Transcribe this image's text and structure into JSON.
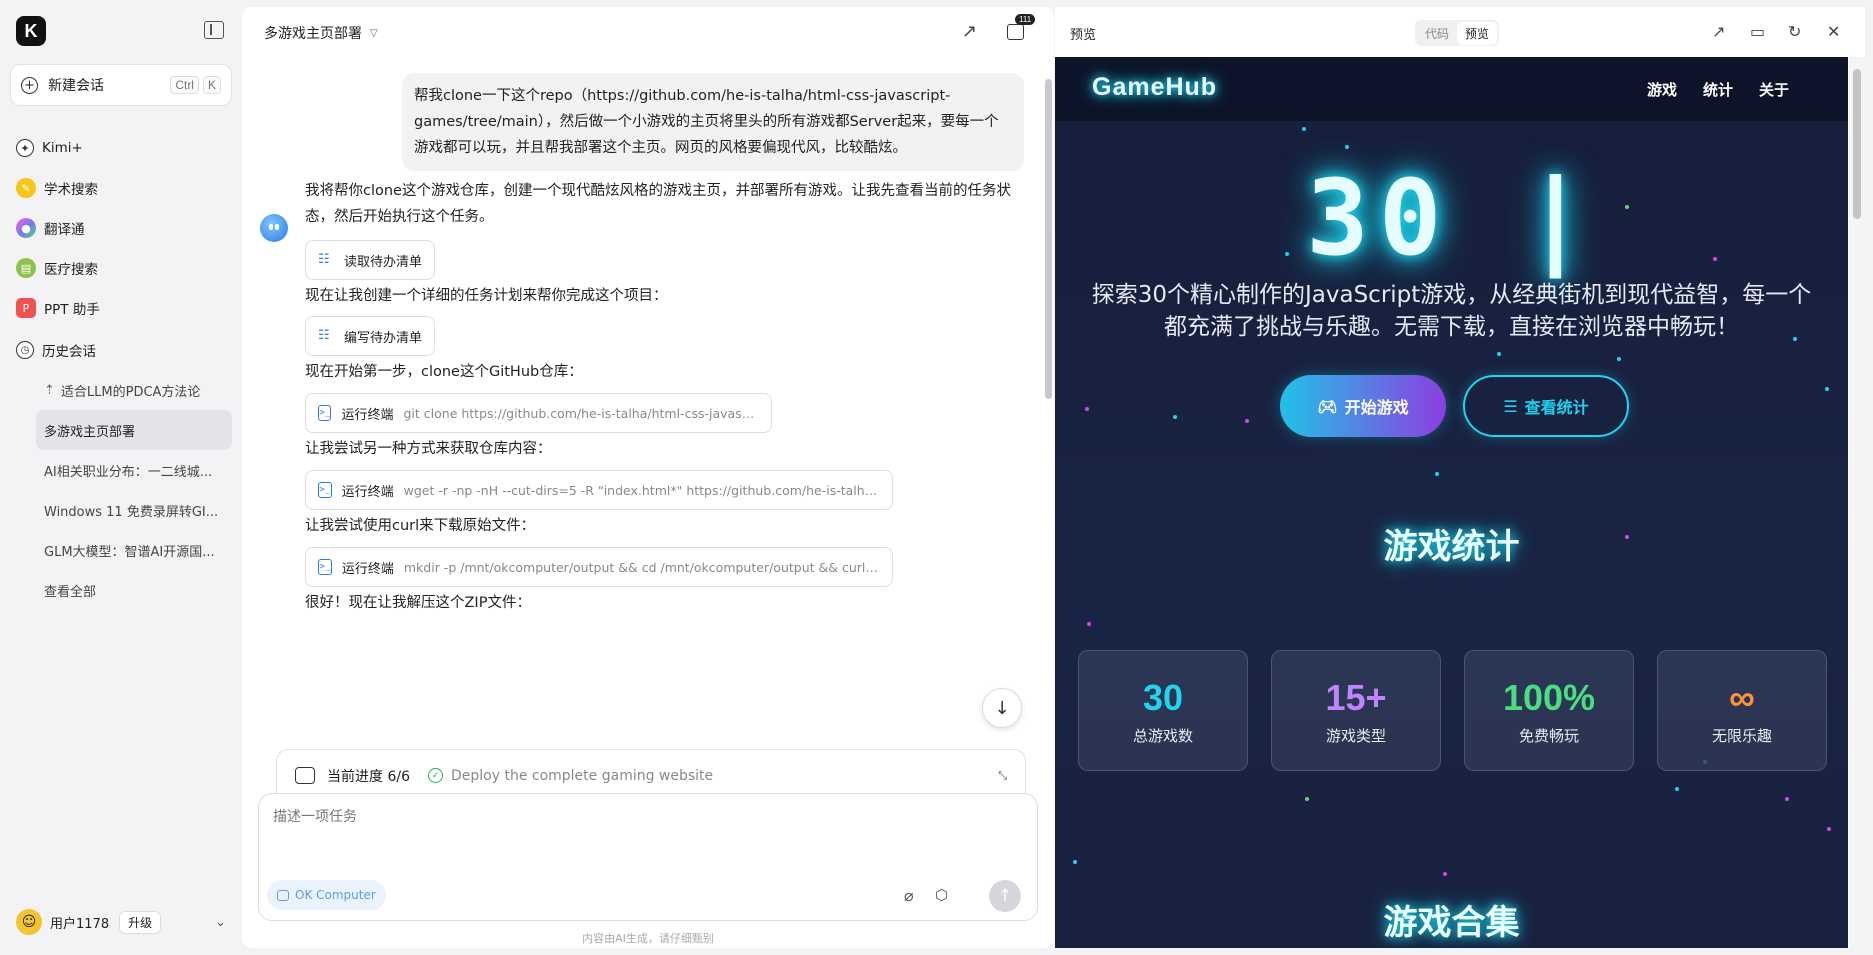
{
  "sidebar": {
    "logo": "K",
    "new_chat": {
      "label": "新建会话",
      "kbd1": "Ctrl",
      "kbd2": "K"
    },
    "nav": [
      {
        "label": "Kimi+"
      },
      {
        "label": "学术搜索"
      },
      {
        "label": "翻译通"
      },
      {
        "label": "医疗搜索"
      },
      {
        "label": "PPT 助手"
      },
      {
        "label": "历史会话"
      }
    ],
    "history": [
      {
        "label": "适合LLM的PDCA方法论"
      },
      {
        "label": "多游戏主页部署"
      },
      {
        "label": "AI相关职业分布：一二线城..."
      },
      {
        "label": "Windows 11 免费录屏转GI..."
      },
      {
        "label": "GLM大模型：智谱AI开源国..."
      },
      {
        "label": "查看全部"
      }
    ],
    "user": {
      "name": "用户1178",
      "upgrade": "升级"
    }
  },
  "chat": {
    "title": "多游戏主页部署",
    "files_badge": "111",
    "user_message": "帮我clone一下这个repo（https://github.com/he-is-talha/html-css-javascript-games/tree/main），然后做一个小游戏的主页将里头的所有游戏都Server起来，要每一个游戏都可以玩，并且帮我部署这个主页。网页的风格要偏现代风，比较酷炫。",
    "messages": [
      "我将帮你clone这个游戏仓库，创建一个现代酷炫风格的游戏主页，并部署所有游戏。让我先查看当前的任务状态，然后开始执行这个任务。",
      "现在让我创建一个详细的任务计划来帮你完成这个项目：",
      "现在开始第一步，clone这个GitHub仓库：",
      "让我尝试另一种方式来获取仓库内容：",
      "让我尝试使用curl来下载原始文件：",
      "很好！现在让我解压这个ZIP文件："
    ],
    "tools": [
      {
        "label": "读取待办清单",
        "cmd": ""
      },
      {
        "label": "编写待办清单",
        "cmd": ""
      },
      {
        "label": "运行终端",
        "cmd": "git clone https://github.com/he-is-talha/html-css-javascript-games.git"
      },
      {
        "label": "运行终端",
        "cmd": "wget -r -np -nH --cut-dirs=5 -R \"index.html*\" https://github.com/he-is-talha/html-css-javas..."
      },
      {
        "label": "运行终端",
        "cmd": "mkdir -p /mnt/okcomputer/output && cd /mnt/okcomputer/output && curl -L https://gith..."
      }
    ],
    "progress": {
      "label": "当前进度 6/6",
      "task": "Deploy the complete gaming website"
    },
    "composer": {
      "placeholder": "描述一项任务",
      "mode_chip": "OK Computer"
    },
    "disclaimer": "内容由AI生成，请仔细甄别"
  },
  "preview": {
    "title": "预览",
    "toggle": {
      "code": "代码",
      "preview": "预览"
    },
    "site": {
      "logo": "GameHub",
      "nav": [
        "游戏",
        "统计",
        "关于"
      ],
      "hero_number": "30 |",
      "hero_desc": "探索30个精心制作的JavaScript游戏，从经典街机到现代益智，每一个都充满了挑战与乐趣。无需下载，直接在浏览器中畅玩！",
      "btn_play": "开始游戏",
      "btn_stats": "查看统计",
      "stats_title": "游戏统计",
      "games_title": "游戏合集",
      "stats": [
        {
          "value": "30",
          "label": "总游戏数",
          "color": "#22d3ee"
        },
        {
          "value": "15+",
          "label": "游戏类型",
          "color": "#c084fc"
        },
        {
          "value": "100%",
          "label": "免费畅玩",
          "color": "#4ade80"
        },
        {
          "value": "∞",
          "label": "无限乐趣",
          "color": "#fb923c"
        }
      ]
    }
  }
}
